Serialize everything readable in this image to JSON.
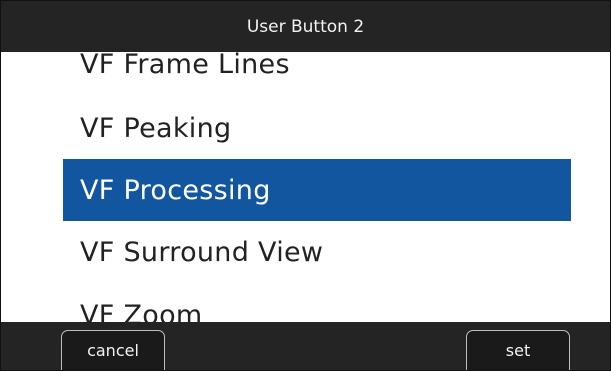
{
  "header": {
    "title": "User Button 2"
  },
  "menu": {
    "items": [
      {
        "label": "VF Frame Lines"
      },
      {
        "label": "VF Peaking"
      },
      {
        "label": "VF Processing"
      },
      {
        "label": "VF Surround View"
      },
      {
        "label": "VF Zoom"
      }
    ],
    "selected": "VF Processing"
  },
  "softkeys": {
    "cancel_label": "cancel",
    "set_label": "set"
  },
  "colors": {
    "highlight": "#1356a0",
    "bar": "#242424",
    "background": "#ffffff"
  }
}
